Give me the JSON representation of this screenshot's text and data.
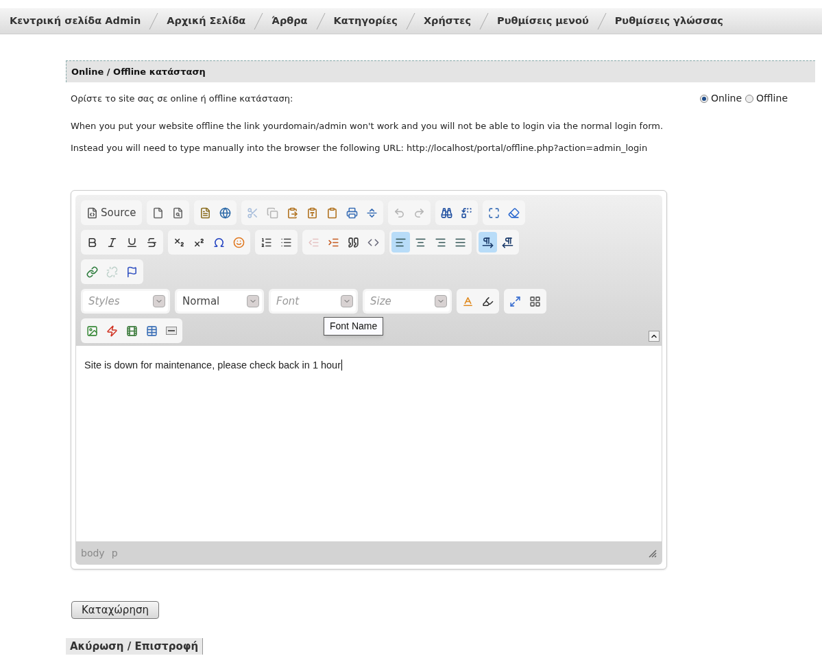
{
  "nav": {
    "items": [
      {
        "label": "Κεντρική σελίδα Admin"
      },
      {
        "label": "Αρχική Σελίδα"
      },
      {
        "label": "Άρθρα"
      },
      {
        "label": "Κατηγορίες"
      },
      {
        "label": "Χρήστες"
      },
      {
        "label": "Ρυθμίσεις μενού"
      },
      {
        "label": "Ρυθμίσεις γλώσσας"
      }
    ]
  },
  "section": {
    "title": "Online / Offline κατάσταση",
    "prompt": "Ορίστε το site σας σε online ή offline κατάσταση:",
    "status_options": [
      {
        "label": "Online",
        "selected": true
      },
      {
        "label": "Offline",
        "selected": false
      }
    ],
    "notes": [
      "When you put your website offline the link yourdomain/admin won't work and you will not be able to login via the normal login form.",
      "Instead you will need to type manually into the browser the following URL: http://localhost/portal/offline.php?action=admin_login"
    ]
  },
  "editor": {
    "toolbar_rows": [
      [
        {
          "buttons": [
            {
              "kind": "source",
              "label": "Source",
              "selected": false,
              "disabled": false
            }
          ]
        },
        {
          "buttons": [
            {
              "kind": "newpage",
              "selected": false,
              "disabled": false
            },
            {
              "kind": "preview",
              "selected": false,
              "disabled": false
            }
          ]
        },
        {
          "buttons": [
            {
              "kind": "templates",
              "selected": false,
              "disabled": false
            },
            {
              "kind": "globe",
              "selected": false,
              "disabled": false
            }
          ]
        },
        {
          "buttons": [
            {
              "kind": "cut",
              "selected": false,
              "disabled": true
            },
            {
              "kind": "copy",
              "selected": false,
              "disabled": true
            },
            {
              "kind": "paste",
              "selected": false,
              "disabled": false
            },
            {
              "kind": "pastetext",
              "selected": false,
              "disabled": false
            },
            {
              "kind": "pasteword",
              "selected": false,
              "disabled": false
            },
            {
              "kind": "print",
              "selected": false,
              "disabled": false
            },
            {
              "kind": "pagebreak",
              "selected": false,
              "disabled": false
            }
          ]
        },
        {
          "buttons": [
            {
              "kind": "undo",
              "selected": false,
              "disabled": true
            },
            {
              "kind": "redo",
              "selected": false,
              "disabled": true
            }
          ]
        },
        {
          "buttons": [
            {
              "kind": "find",
              "selected": false,
              "disabled": false
            },
            {
              "kind": "replace",
              "selected": false,
              "disabled": false
            }
          ]
        },
        {
          "buttons": [
            {
              "kind": "selectall",
              "selected": false,
              "disabled": false
            },
            {
              "kind": "eraser",
              "selected": false,
              "disabled": false
            }
          ]
        }
      ],
      [
        {
          "buttons": [
            {
              "kind": "bold",
              "selected": false,
              "disabled": false
            },
            {
              "kind": "italic",
              "selected": false,
              "disabled": false
            },
            {
              "kind": "underline",
              "selected": false,
              "disabled": false
            },
            {
              "kind": "strike",
              "selected": false,
              "disabled": false
            }
          ]
        },
        {
          "buttons": [
            {
              "kind": "subscript",
              "selected": false,
              "disabled": false
            },
            {
              "kind": "superscript",
              "selected": false,
              "disabled": false
            },
            {
              "kind": "omega",
              "selected": false,
              "disabled": false
            },
            {
              "kind": "smiley",
              "selected": false,
              "disabled": false
            }
          ]
        },
        {
          "buttons": [
            {
              "kind": "numbered",
              "selected": false,
              "disabled": false
            },
            {
              "kind": "bulleted",
              "selected": false,
              "disabled": false
            }
          ]
        },
        {
          "buttons": [
            {
              "kind": "outdent",
              "selected": false,
              "disabled": true
            },
            {
              "kind": "indent",
              "selected": false,
              "disabled": false
            },
            {
              "kind": "quote",
              "selected": false,
              "disabled": false
            },
            {
              "kind": "div",
              "selected": false,
              "disabled": false
            }
          ]
        },
        {
          "buttons": [
            {
              "kind": "alignleft",
              "selected": true,
              "disabled": false
            },
            {
              "kind": "aligncenter",
              "selected": false,
              "disabled": false
            },
            {
              "kind": "alignright",
              "selected": false,
              "disabled": false
            },
            {
              "kind": "justify",
              "selected": false,
              "disabled": false
            }
          ]
        },
        {
          "buttons": [
            {
              "kind": "ltr",
              "selected": true,
              "disabled": false
            },
            {
              "kind": "rtl",
              "selected": false,
              "disabled": false
            }
          ]
        }
      ],
      [
        {
          "buttons": [
            {
              "kind": "link",
              "selected": false,
              "disabled": false
            },
            {
              "kind": "unlink",
              "selected": false,
              "disabled": true
            },
            {
              "kind": "anchor",
              "selected": false,
              "disabled": false
            }
          ]
        }
      ],
      [
        {
          "buttons": [
            {
              "kind": "combo",
              "placeholder": "Styles",
              "selected": false,
              "disabled": false
            }
          ]
        },
        {
          "buttons": [
            {
              "kind": "combo",
              "value": "Normal",
              "selected": false,
              "disabled": false
            }
          ]
        },
        {
          "buttons": [
            {
              "kind": "combo",
              "placeholder": "Font",
              "selected": false,
              "disabled": false
            }
          ]
        },
        {
          "buttons": [
            {
              "kind": "combo",
              "placeholder": "Size",
              "selected": false,
              "disabled": false
            }
          ]
        },
        {
          "buttons": [
            {
              "kind": "textcolor",
              "selected": false,
              "disabled": false
            },
            {
              "kind": "bgcolor",
              "selected": false,
              "disabled": false
            }
          ]
        },
        {
          "buttons": [
            {
              "kind": "maximize",
              "selected": false,
              "disabled": false
            },
            {
              "kind": "showblocks",
              "selected": false,
              "disabled": false
            }
          ]
        }
      ],
      [
        {
          "buttons": [
            {
              "kind": "image",
              "selected": false,
              "disabled": false
            },
            {
              "kind": "flash",
              "selected": false,
              "disabled": false
            },
            {
              "kind": "media",
              "selected": false,
              "disabled": false
            },
            {
              "kind": "table",
              "selected": false,
              "disabled": false
            },
            {
              "kind": "rule",
              "selected": false,
              "disabled": false
            }
          ]
        }
      ]
    ],
    "tooltip": {
      "text": "Font Name"
    },
    "content": "Site is down for maintenance, please check back in 1 hour",
    "path": [
      "body",
      "p"
    ]
  },
  "buttons": {
    "save": "Καταχώρηση",
    "cancel": "Ακύρωση / Επιστροφή"
  }
}
